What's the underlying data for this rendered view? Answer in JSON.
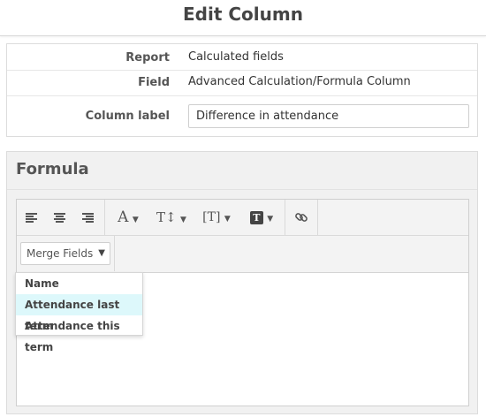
{
  "page": {
    "title": "Edit Column"
  },
  "info": {
    "report_label": "Report",
    "report_value": "Calculated fields",
    "field_label": "Field",
    "field_value": "Advanced Calculation/Formula Column",
    "column_label_label": "Column label",
    "column_label_value": "Difference in attendance"
  },
  "formula": {
    "title": "Formula",
    "toolbar": {
      "font_label": "A",
      "size_label": "T↕",
      "format_label": "[T]",
      "style_label": "T",
      "caret": "▼"
    },
    "merge_fields": {
      "label": "Merge Fields",
      "caret": "▼",
      "options": [
        "Name",
        "Attendance last term",
        "Attendance this term"
      ],
      "highlighted_index": 1
    }
  }
}
